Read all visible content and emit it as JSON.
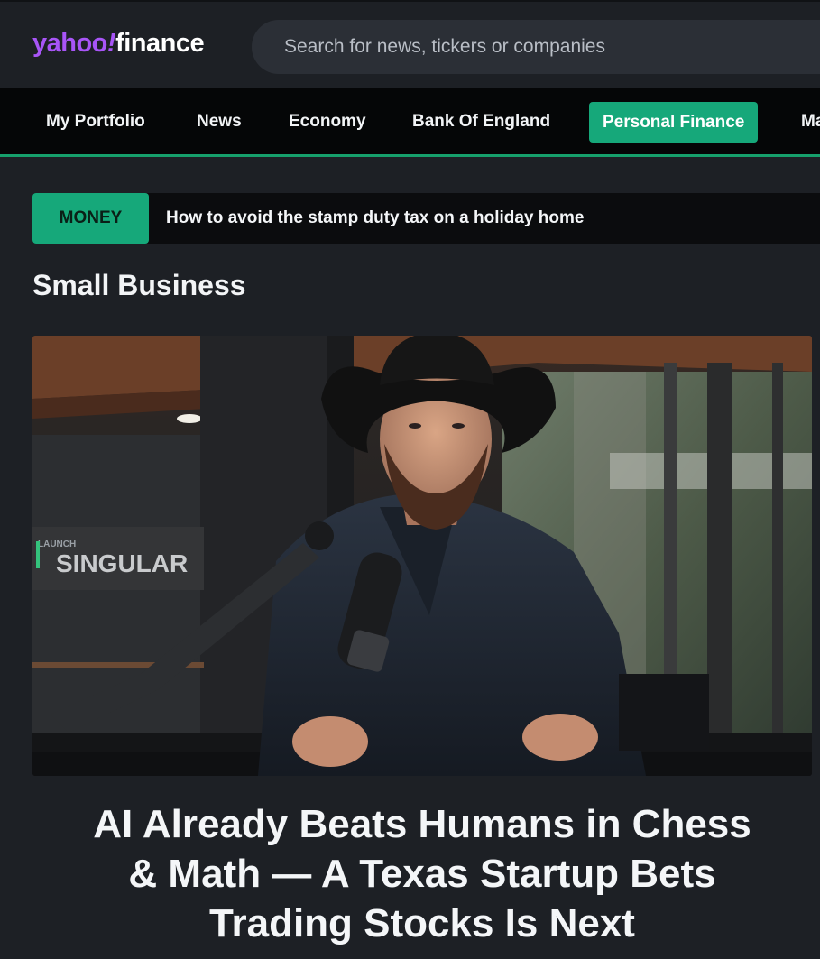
{
  "header": {
    "logo_yahoo": "yahoo",
    "logo_slash": "!",
    "logo_finance": "finance",
    "search_placeholder": "Search for news, tickers or companies"
  },
  "nav": {
    "items": [
      {
        "label": "My Portfolio",
        "active": false
      },
      {
        "label": "News",
        "active": false
      },
      {
        "label": "Economy",
        "active": false
      },
      {
        "label": "Bank Of England",
        "active": false
      },
      {
        "label": "Personal Finance",
        "active": true
      },
      {
        "label": "Ma",
        "active": false
      }
    ]
  },
  "ticker": {
    "tag": "MONEY",
    "text": "How to avoid the stamp duty tax on a holiday home"
  },
  "section": {
    "title": "Small Business"
  },
  "hero": {
    "sign_text": "SINGULAR"
  },
  "article": {
    "headline_lines": [
      "AI Already Beats Humans in Chess",
      "& Math — A Texas Startup Bets",
      "Trading Stocks Is Next"
    ]
  },
  "colors": {
    "accent": "#16a87a",
    "brand_purple": "#a855f7",
    "background": "#1d2025"
  }
}
